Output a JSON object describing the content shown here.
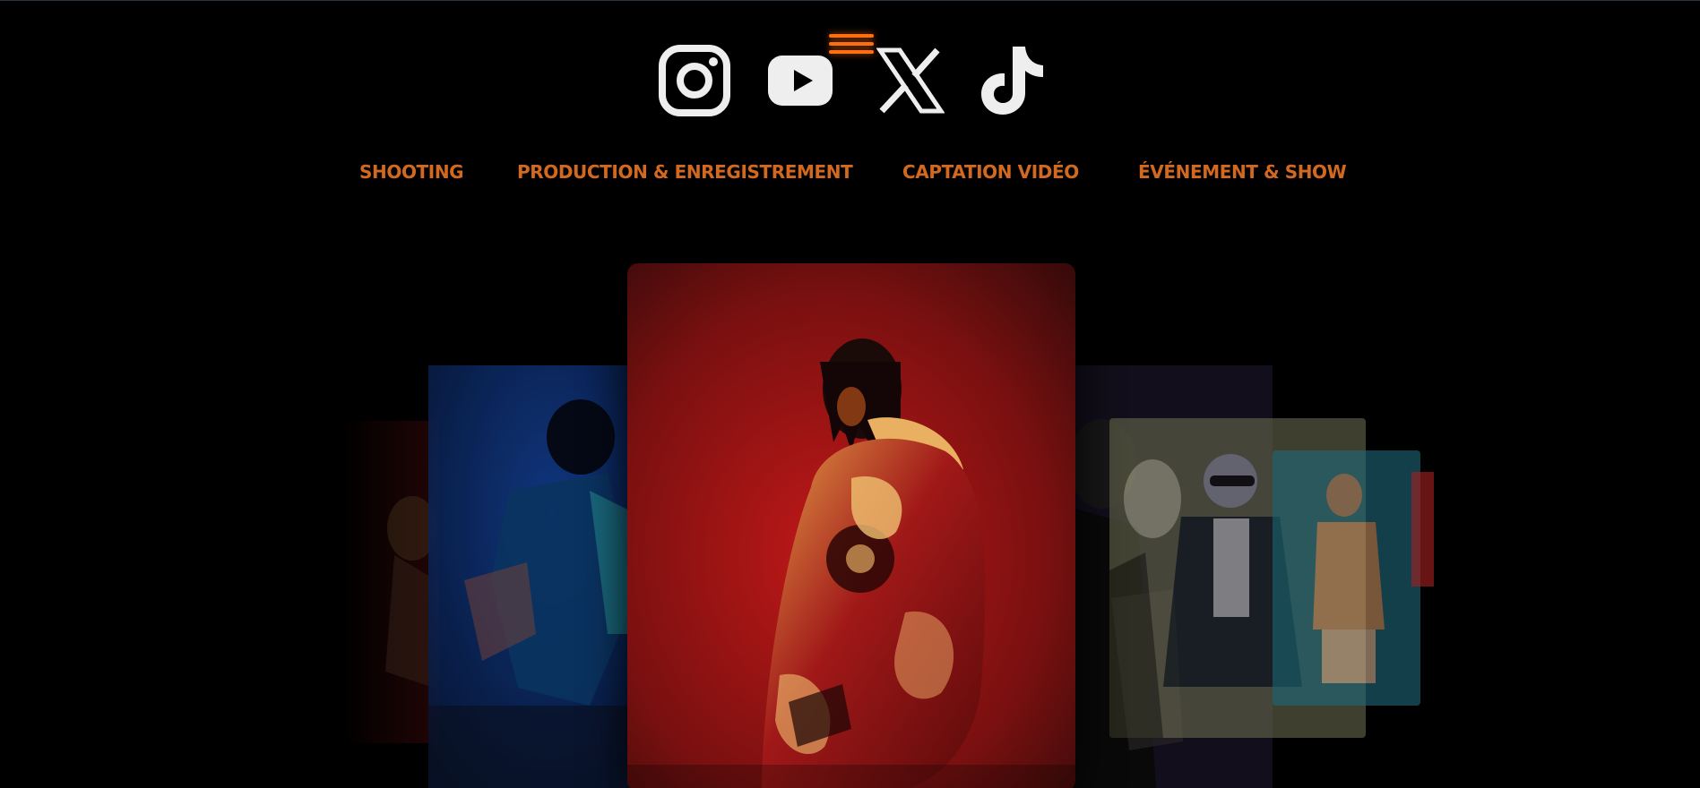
{
  "header": {
    "menu_icon": "hamburger-menu-icon",
    "accent_color": "#ff6f0f"
  },
  "social": [
    {
      "name": "Instagram",
      "icon": "instagram-icon"
    },
    {
      "name": "YouTube",
      "icon": "youtube-icon"
    },
    {
      "name": "X",
      "icon": "x-icon"
    },
    {
      "name": "TikTok",
      "icon": "tiktok-icon"
    }
  ],
  "nav": {
    "items": [
      {
        "label": "SHOOTING"
      },
      {
        "label": "PRODUCTION & ENREGISTREMENT"
      },
      {
        "label": "CAPTATION VIDÉO"
      },
      {
        "label": "ÉVÉNEMENT & SHOW"
      }
    ],
    "color": "#d2691e"
  },
  "gallery": {
    "cards": [
      {
        "name": "photo-red-far-left",
        "tone": "#3a0a0a"
      },
      {
        "name": "photo-blue-left",
        "tone": "#0b2a6a"
      },
      {
        "name": "photo-featured-red-jacket",
        "tone": "#b01818"
      },
      {
        "name": "photo-purple-right",
        "tone": "#2a1a4a"
      },
      {
        "name": "photo-olive-right",
        "tone": "#6a6a50"
      },
      {
        "name": "photo-teal-right",
        "tone": "#1e6a7a"
      }
    ]
  }
}
